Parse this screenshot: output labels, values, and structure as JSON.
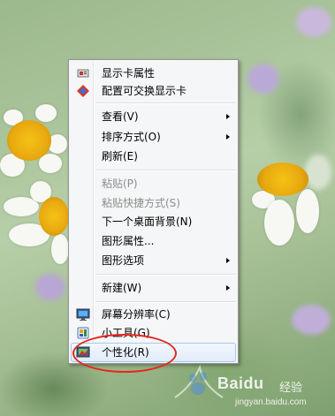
{
  "context_menu": {
    "items": [
      {
        "label": "显示卡属性",
        "icon": "graphics-card-icon",
        "disabled": false,
        "submenu": false
      },
      {
        "label": "配置可交换显示卡",
        "icon": "swap-graphics-icon",
        "disabled": false,
        "submenu": false
      },
      {
        "label": "查看(V)",
        "disabled": false,
        "submenu": true
      },
      {
        "label": "排序方式(O)",
        "disabled": false,
        "submenu": true
      },
      {
        "label": "刷新(E)",
        "disabled": false,
        "submenu": false
      },
      {
        "label": "粘贴(P)",
        "disabled": true,
        "submenu": false
      },
      {
        "label": "粘贴快捷方式(S)",
        "disabled": true,
        "submenu": false
      },
      {
        "label": "下一个桌面背景(N)",
        "disabled": false,
        "submenu": false
      },
      {
        "label": "图形属性...",
        "disabled": false,
        "submenu": false
      },
      {
        "label": "图形选项",
        "disabled": false,
        "submenu": true
      },
      {
        "label": "新建(W)",
        "disabled": false,
        "submenu": true
      },
      {
        "label": "屏幕分辨率(C)",
        "icon": "screen-resolution-icon",
        "disabled": false,
        "submenu": false
      },
      {
        "label": "小工具(G)",
        "icon": "gadgets-icon",
        "disabled": false,
        "submenu": false
      },
      {
        "label": "个性化(R)",
        "icon": "personalize-icon",
        "disabled": false,
        "submenu": false,
        "highlighted": true
      }
    ]
  },
  "annotation": {
    "color": "#e8261c",
    "target": "个性化(R)"
  },
  "watermark": {
    "logo": "Baidu",
    "label": "经验",
    "url": "jingyan.baidu.com"
  }
}
